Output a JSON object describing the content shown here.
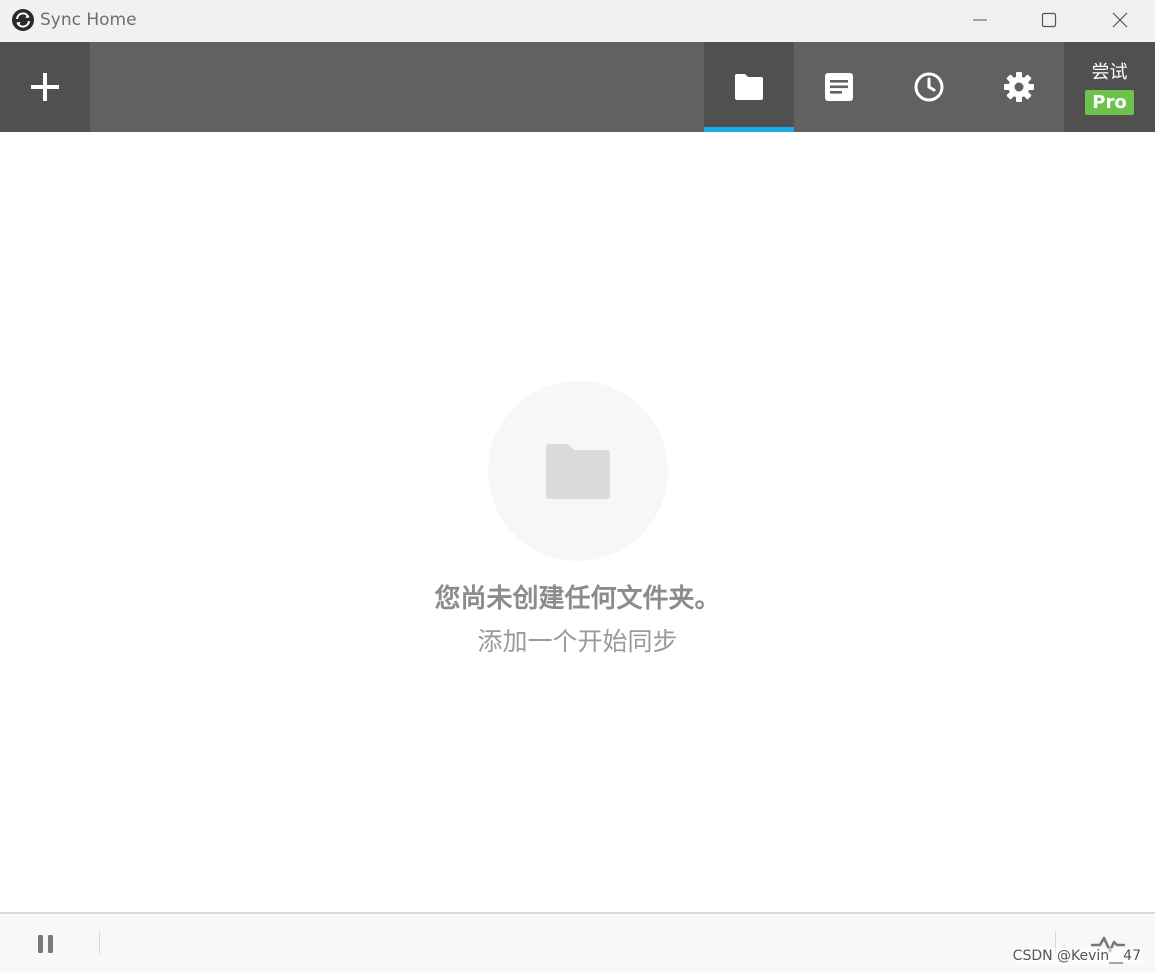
{
  "window": {
    "title": "Sync Home",
    "app_icon": "sync-logo-icon"
  },
  "toolbar": {
    "add_icon": "plus-icon",
    "tabs": [
      {
        "name": "folders",
        "icon": "folder-icon",
        "active": true
      },
      {
        "name": "notes",
        "icon": "document-icon",
        "active": false
      },
      {
        "name": "history",
        "icon": "clock-icon",
        "active": false
      },
      {
        "name": "settings",
        "icon": "gear-icon",
        "active": false
      }
    ],
    "pro": {
      "try_label": "尝试",
      "badge_label": "Pro"
    }
  },
  "empty_state": {
    "icon": "folder-icon",
    "title": "您尚未创建任何文件夹。",
    "subtitle": "添加一个开始同步"
  },
  "statusbar": {
    "pause_icon": "pause-icon",
    "activity_icon": "activity-icon",
    "watermark": "CSDN @Kevin__47"
  },
  "colors": {
    "toolbar_bg": "#616161",
    "active_tab_bg": "#505050",
    "active_tab_underline": "#1aa9e9",
    "pro_badge": "#6cc24a"
  }
}
